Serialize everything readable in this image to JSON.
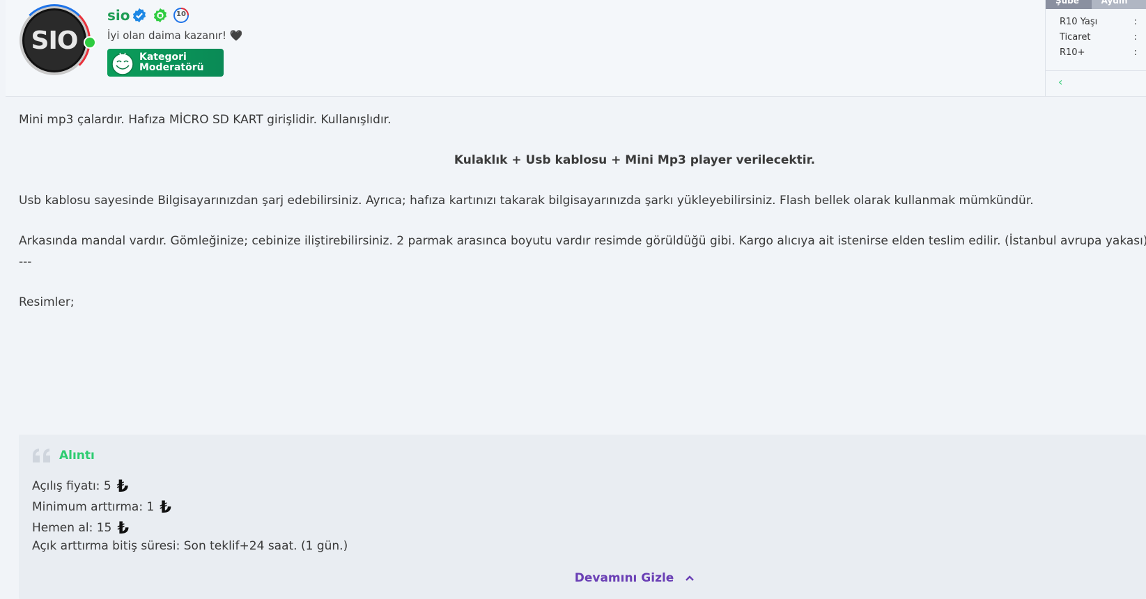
{
  "user": {
    "username": "sio",
    "avatar_text": "SIO",
    "tagline": "İyi olan daima kazanır! 🖤",
    "level_badge": "10",
    "mod_badge_line1": "Kategori",
    "mod_badge_line2": "Moderatörü"
  },
  "side_panel": {
    "tabs": [
      "Şube",
      "Aydın"
    ],
    "rows": [
      {
        "label": "R10 Yaşı",
        "value": ":"
      },
      {
        "label": "Ticaret",
        "value": ":"
      },
      {
        "label": "R10+",
        "value": ":"
      }
    ]
  },
  "content": {
    "p1": "Mini mp3 çalardır. Hafıza MİCRO SD KART girişlidir. Kullanışlıdır.",
    "p2": "Kulaklık + Usb kablosu + Mini Mp3 player verilecektir.",
    "p3": "Usb kablosu sayesinde Bilgisayarınızdan şarj edebilirsiniz. Ayrıca; hafıza kartınızı takarak bilgisayarınızda şarkı yükleyebilirsiniz. Flash bellek olarak kullanmak mümkündür.",
    "p4": "Arkasında mandal vardır. Gömleğinize; cebinize iliştirebilirsiniz. 2 parmak arasınca boyutu vardır resimde görüldüğü gibi. Kargo alıcıya ait istenirse elden teslim edilir. (İstanbul avrupa yakası)",
    "separator": "---",
    "p5": "Resimler;"
  },
  "quote": {
    "label": "Alıntı",
    "line1": "Açılış fiyatı: 5",
    "line2": "Minimum arttırma: 1",
    "line3": "Hemen al: 15",
    "line4": "Açık arttırma bitiş süresi: Son teklif+24 saat. (1 gün.)",
    "currency": "₺",
    "toggle_label": "Devamını Gizle"
  },
  "colors": {
    "accent_green": "#2ecc71",
    "username_green": "#1f9d55",
    "toggle_purple": "#6a3fb5"
  }
}
